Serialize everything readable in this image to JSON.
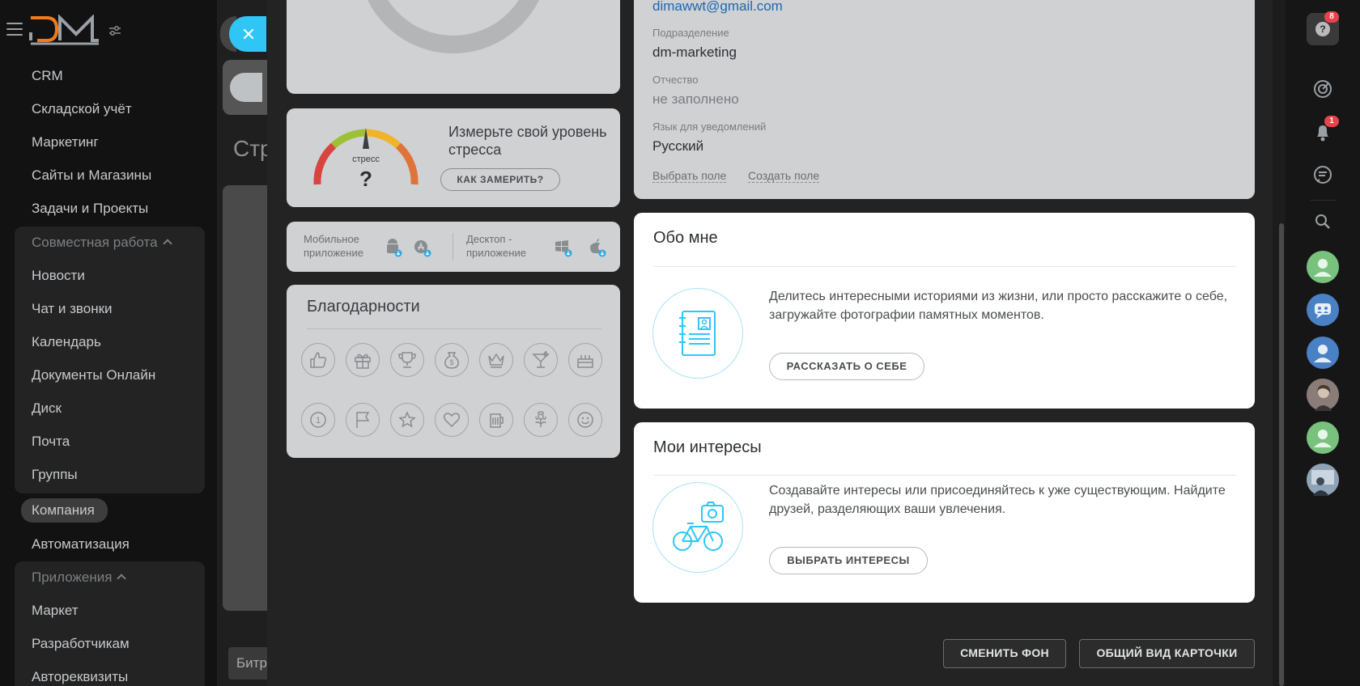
{
  "sidebar": {
    "items": [
      {
        "label": "CRM"
      },
      {
        "label": "Складской учёт"
      },
      {
        "label": "Маркетинг"
      },
      {
        "label": "Сайты и Магазины"
      },
      {
        "label": "Задачи и Проекты"
      }
    ],
    "group_collab": {
      "title": "Совместная работа",
      "items": [
        "Новости",
        "Чат и звонки",
        "Календарь",
        "Документы Онлайн",
        "Диск",
        "Почта",
        "Группы"
      ]
    },
    "company": "Компания",
    "automation": "Автоматизация",
    "group_apps": {
      "title": "Приложения",
      "items": [
        "Маркет",
        "Разработчикам",
        "Автореквизиты"
      ]
    }
  },
  "background": {
    "title_fragment": "Стр",
    "bottom_fragment": "Битр"
  },
  "stress": {
    "title": "Измерьте свой уровень стресса",
    "gauge_label": "стресс",
    "gauge_value": "?",
    "button": "КАК ЗАМЕРИТЬ?"
  },
  "apps": {
    "mobile": "Мобильное приложение",
    "desktop": "Десктоп - приложение"
  },
  "thanks": {
    "title": "Благодарности",
    "badges": [
      "thumbs-up-icon",
      "gift-icon",
      "trophy-icon",
      "money-bag-icon",
      "crown-icon",
      "cocktail-icon",
      "cake-icon",
      "number-one-icon",
      "flag-icon",
      "star-icon",
      "heart-icon",
      "beer-icon",
      "flower-icon",
      "smile-icon"
    ]
  },
  "profile": {
    "email": "dimawwt@gmail.com",
    "department_label": "Подразделение",
    "department_value": "dm-marketing",
    "patronymic_label": "Отчество",
    "patronymic_value": "не заполнено",
    "language_label": "Язык для уведомлений",
    "language_value": "Русский",
    "choose_field": "Выбрать поле",
    "create_field": "Создать поле"
  },
  "about": {
    "title": "Обо мне",
    "text": "Делитесь интересными историями из жизни, или просто расскажите о себе, загружайте фотографии памятных моментов.",
    "button": "РАССКАЗАТЬ О СЕБЕ"
  },
  "interests": {
    "title": "Мои интересы",
    "text": "Создавайте интересы или присоединяйтесь к уже существующим. Найдите друзей, разделяющих ваши увлечения.",
    "button": "ВЫБРАТЬ ИНТЕРЕСЫ"
  },
  "footer": {
    "change_bg": "СМЕНИТЬ ФОН",
    "general_view": "ОБЩИЙ ВИД КАРТОЧКИ"
  },
  "rightbar": {
    "help_badge": "8",
    "notify_badge": "1"
  },
  "colors": {
    "accent": "#2fc6f6",
    "link": "#2067b0",
    "badge": "#e8434a",
    "avatar_green": "#78c27e",
    "avatar_blue": "#4a80c4"
  }
}
